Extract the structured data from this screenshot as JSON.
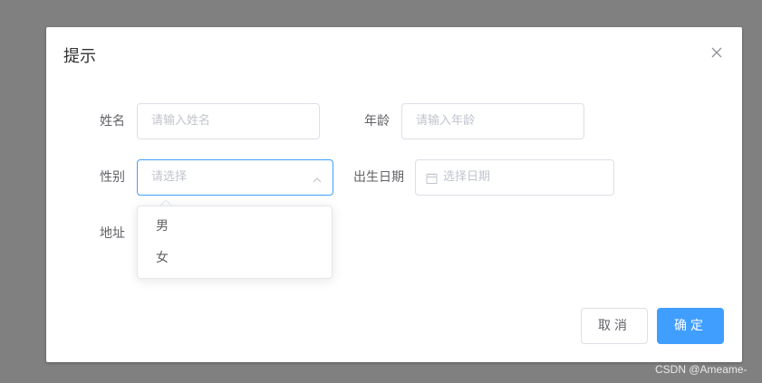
{
  "dialog": {
    "title": "提示",
    "close_icon": "close-icon"
  },
  "form": {
    "name": {
      "label": "姓名",
      "placeholder": "请输入姓名"
    },
    "age": {
      "label": "年龄",
      "placeholder": "请输入年龄"
    },
    "gender": {
      "label": "性别",
      "placeholder": "请选择",
      "expanded": true,
      "icon": "chevron-up-icon"
    },
    "birthdate": {
      "label": "出生日期",
      "placeholder": "选择日期",
      "icon": "calendar-icon"
    },
    "address": {
      "label": "地址"
    }
  },
  "dropdown": {
    "options": [
      "男",
      "女"
    ]
  },
  "footer": {
    "cancel_label": "取消",
    "confirm_label": "确定"
  },
  "watermark": "CSDN @Ameame-",
  "colors": {
    "primary": "#409eff",
    "overlay": "#808080",
    "placeholder": "#c0c4cc",
    "label": "#606266"
  }
}
